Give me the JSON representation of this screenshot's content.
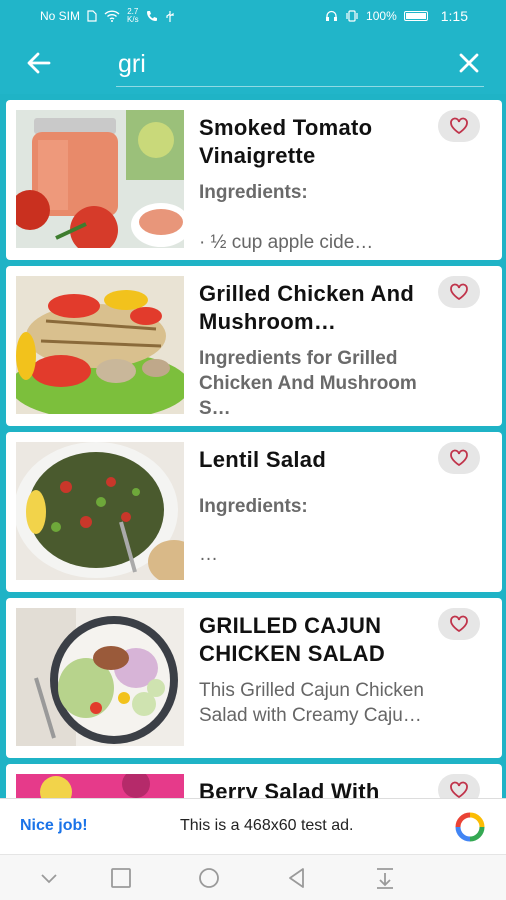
{
  "status_bar": {
    "left_text": "No SIM",
    "speed_value": "2.7",
    "speed_unit": "K/s",
    "battery": "100%",
    "time": "1:15"
  },
  "search": {
    "query": "gri"
  },
  "icons": {
    "back": "arrow-left-icon",
    "clear": "close-icon",
    "favorite": "heart-outline-icon"
  },
  "results": [
    {
      "title": "Smoked Tomato Vinaigrette",
      "line1": "Ingredients:",
      "line2": "· ½ cup apple cide…"
    },
    {
      "title": "Grilled Chicken And Mushroom…",
      "description": "Ingredients for Grilled Chicken And Mushroom S…"
    },
    {
      "title": "Lentil Salad",
      "line1": "Ingredients:",
      "line2": "…"
    },
    {
      "title": "GRILLED CAJUN CHICKEN SALAD",
      "description": "This Grilled Cajun Chicken Salad with Creamy Caju…"
    },
    {
      "title": "Berry Salad With"
    }
  ],
  "ad": {
    "label": "Nice job!",
    "text": "This is a 468x60 test ad."
  },
  "colors": {
    "accent": "#21b5c9",
    "heart": "#c0344b"
  }
}
